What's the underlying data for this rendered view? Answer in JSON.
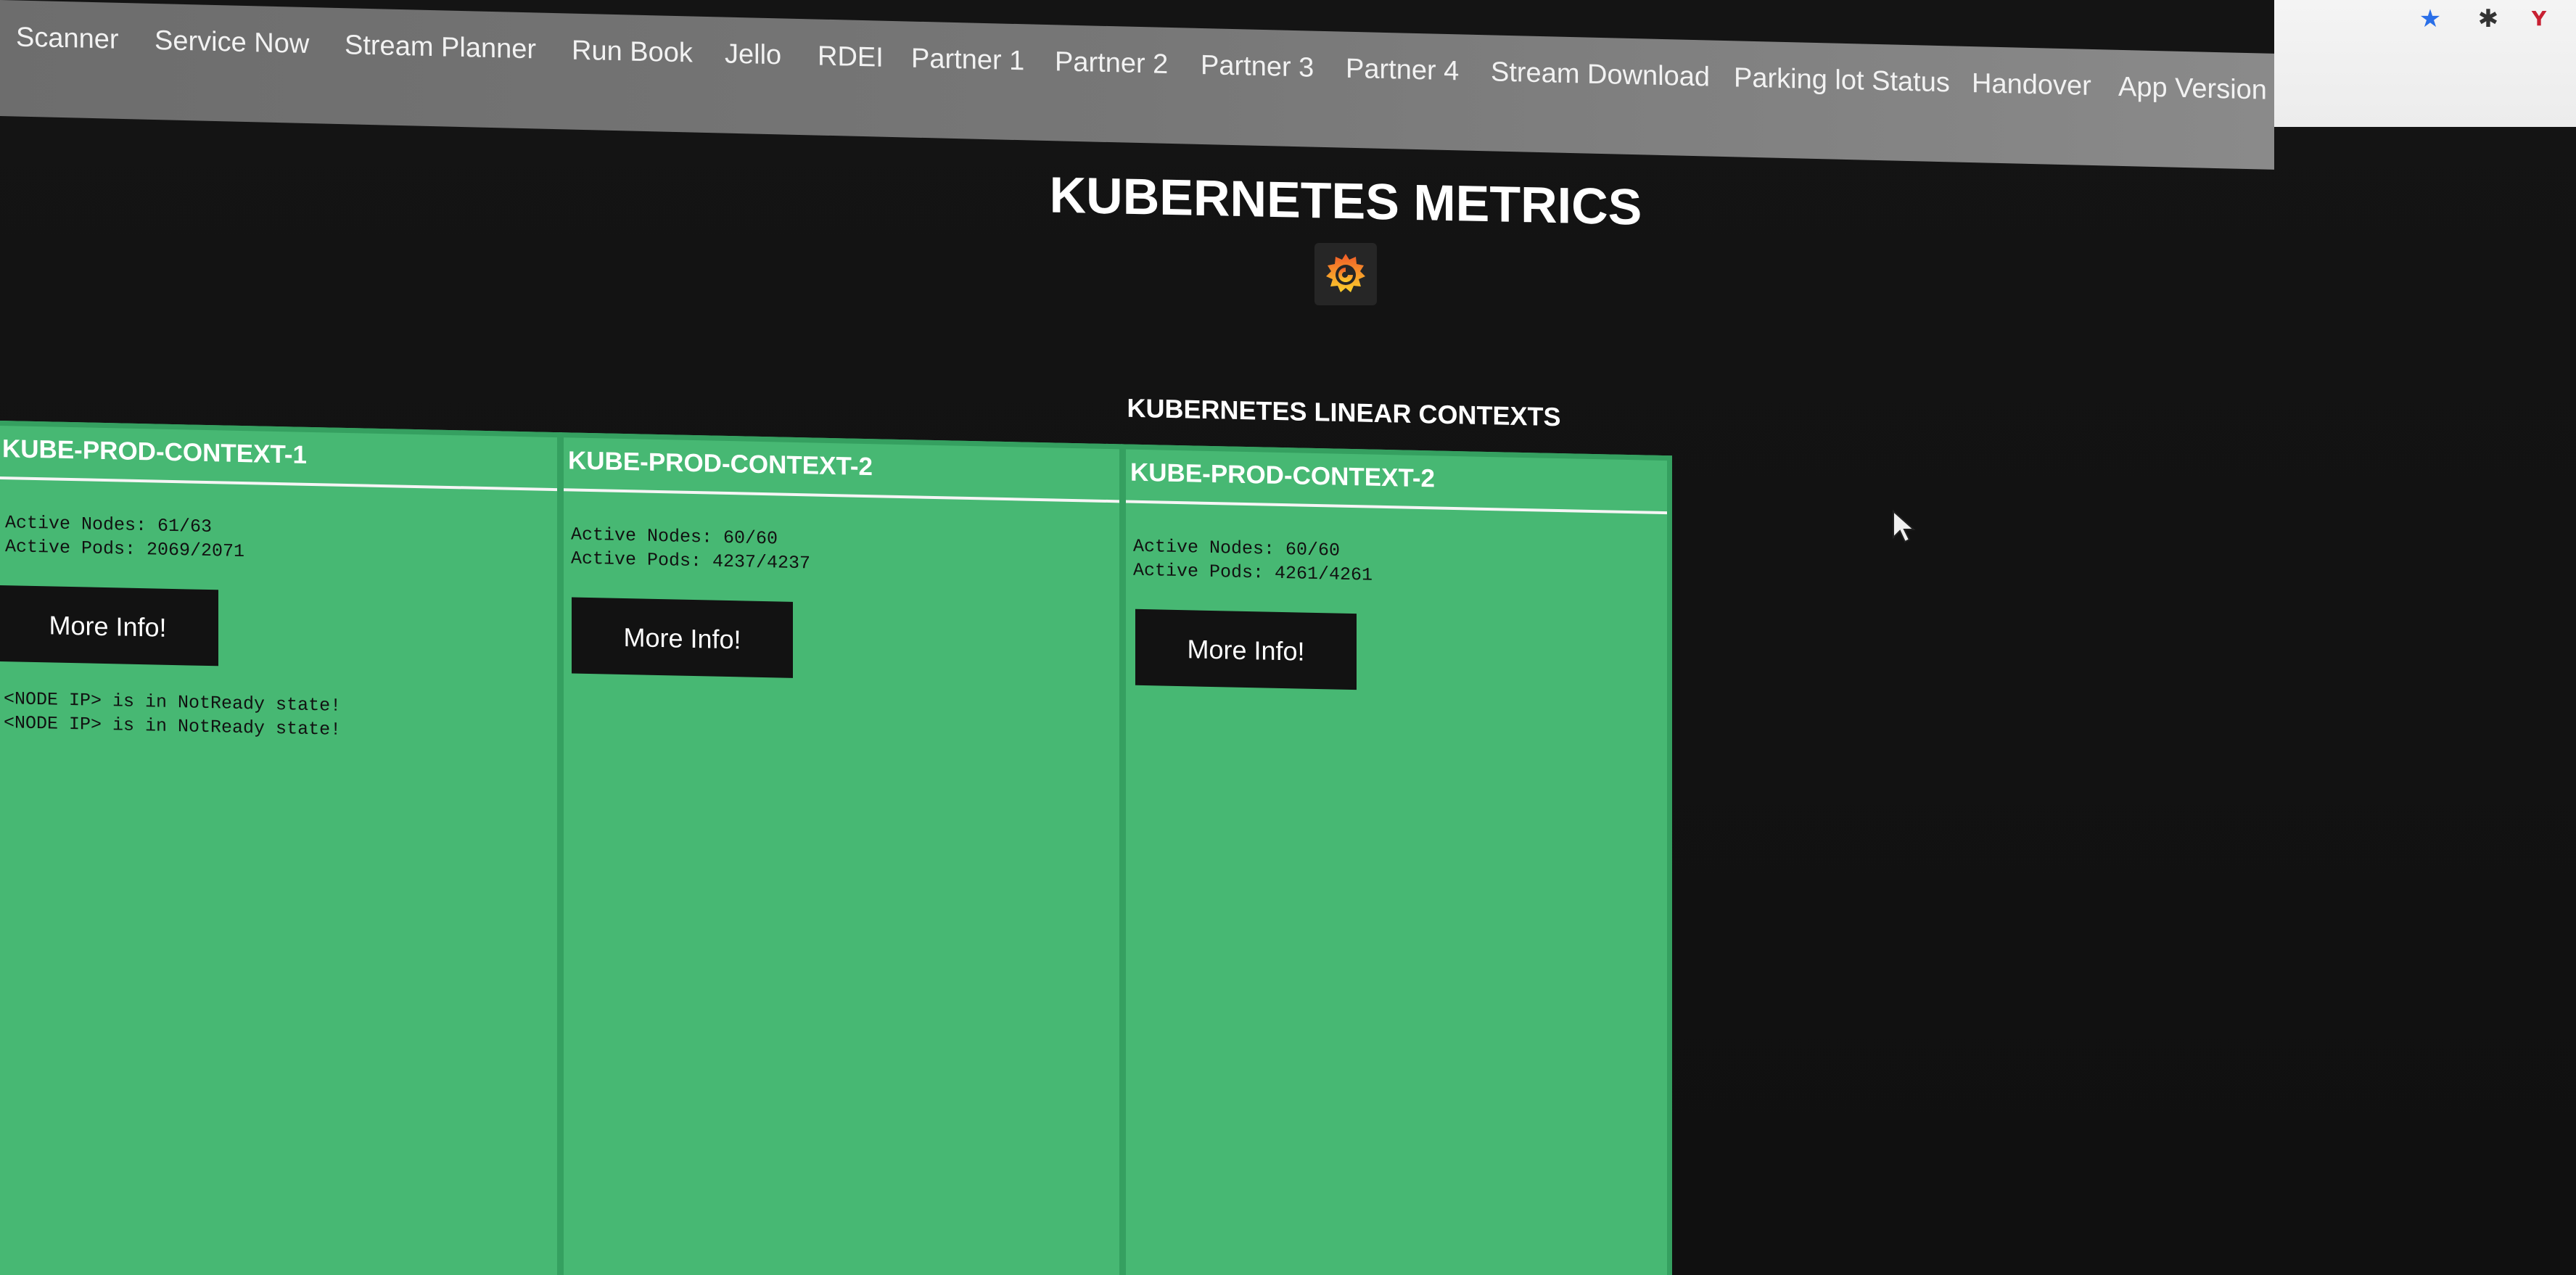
{
  "nav": {
    "items": [
      {
        "label": "Scanner"
      },
      {
        "label": "Service Now"
      },
      {
        "label": "Stream Planner"
      },
      {
        "label": "Run Book"
      },
      {
        "label": "Jello"
      },
      {
        "label": "RDEI"
      },
      {
        "label": "Partner 1"
      },
      {
        "label": "Partner 2"
      },
      {
        "label": "Partner 3"
      },
      {
        "label": "Partner 4"
      },
      {
        "label": "Stream Download"
      },
      {
        "label": "Parking lot Status"
      },
      {
        "label": "Handover"
      },
      {
        "label": "App Version"
      }
    ]
  },
  "browser": {
    "icons": [
      "star-icon",
      "puzzle-icon",
      "extension-icon"
    ],
    "star_glyph": "★",
    "puzzle_glyph": "✱",
    "ext_glyph": "Y"
  },
  "header": {
    "title": "KUBERNETES METRICS",
    "logo_icon": "grafana-logo-icon",
    "subtitle": "KUBERNETES LINEAR CONTEXTS"
  },
  "contexts": [
    {
      "name": "KUBE-PROD-CONTEXT-1",
      "metrics": "Active Nodes: 61/63\nActive Pods: 2069/2071",
      "button_label": "More Info!",
      "alerts": "<NODE IP> is in NotReady state!\n<NODE IP> is in NotReady state!"
    },
    {
      "name": "KUBE-PROD-CONTEXT-2",
      "metrics": "Active Nodes: 60/60\nActive Pods: 4237/4237",
      "button_label": "More Info!",
      "alerts": ""
    },
    {
      "name": "KUBE-PROD-CONTEXT-2",
      "metrics": "Active Nodes: 60/60\nActive Pods: 4261/4261",
      "button_label": "More Info!",
      "alerts": ""
    }
  ],
  "colors": {
    "panel_green": "#47b873",
    "panel_border": "#35a060",
    "nav_bg": "#777777",
    "button_bg": "#121212",
    "page_bg": "#121212",
    "grafana_orange": "#f46800"
  }
}
